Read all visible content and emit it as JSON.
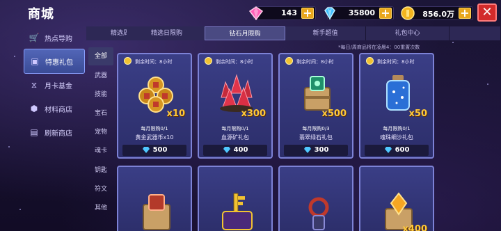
{
  "header": {
    "title": "商城",
    "currencies": [
      {
        "icon": "pink-gem-icon",
        "value": "143"
      },
      {
        "icon": "blue-diamond-icon",
        "value": "35800"
      },
      {
        "icon": "gold-coin-icon",
        "value": "856.0万"
      }
    ],
    "close_label": "✕"
  },
  "sidebar": {
    "items": [
      {
        "label": "热点导购",
        "icon": "cart-icon"
      },
      {
        "label": "特惠礼包",
        "icon": "gift-icon",
        "active": true
      },
      {
        "label": "月卡基金",
        "icon": "hourglass-icon"
      },
      {
        "label": "材料商店",
        "icon": "materials-icon"
      },
      {
        "label": "刷新商店",
        "icon": "refresh-shop-icon"
      }
    ]
  },
  "tabs": [
    {
      "label": "精选周限购"
    },
    {
      "label": "精选日限购"
    },
    {
      "label": "钻石月限购",
      "active": true
    },
    {
      "label": "新手超值"
    },
    {
      "label": "礼包中心"
    }
  ],
  "categories": [
    "全部",
    "武器",
    "技能",
    "宝石",
    "宠物",
    "魂卡",
    "钥匙",
    "符文",
    "其他"
  ],
  "notice": "*每日/周商品将在凌晨4：00重置次数",
  "cards": [
    {
      "timer": "剩余时间：8小时",
      "multiplier": "x10",
      "limit": "每月限购0/1",
      "name": "黄金武器币x10",
      "price": "500"
    },
    {
      "timer": "剩余时间：8小时",
      "multiplier": "x300",
      "limit": "每月限购0/1",
      "name": "血源矿礼包",
      "price": "400"
    },
    {
      "timer": "剩余时间：8小时",
      "multiplier": "x500",
      "limit": "每月限购0/3",
      "name": "翡翠绿石礼包",
      "price": "300"
    },
    {
      "timer": "剩余时间：8小时",
      "multiplier": "x50",
      "limit": "每月限购0/1",
      "name": "魂珠细沙礼包",
      "price": "600"
    }
  ],
  "cards_row2": [
    {
      "multiplier": ""
    },
    {
      "multiplier": ""
    },
    {
      "multiplier": ""
    },
    {
      "multiplier": "x400"
    }
  ],
  "colors": {
    "accent_gold": "#ffc93a",
    "card_border": "#7d82d6",
    "close_red": "#d22a2a"
  }
}
